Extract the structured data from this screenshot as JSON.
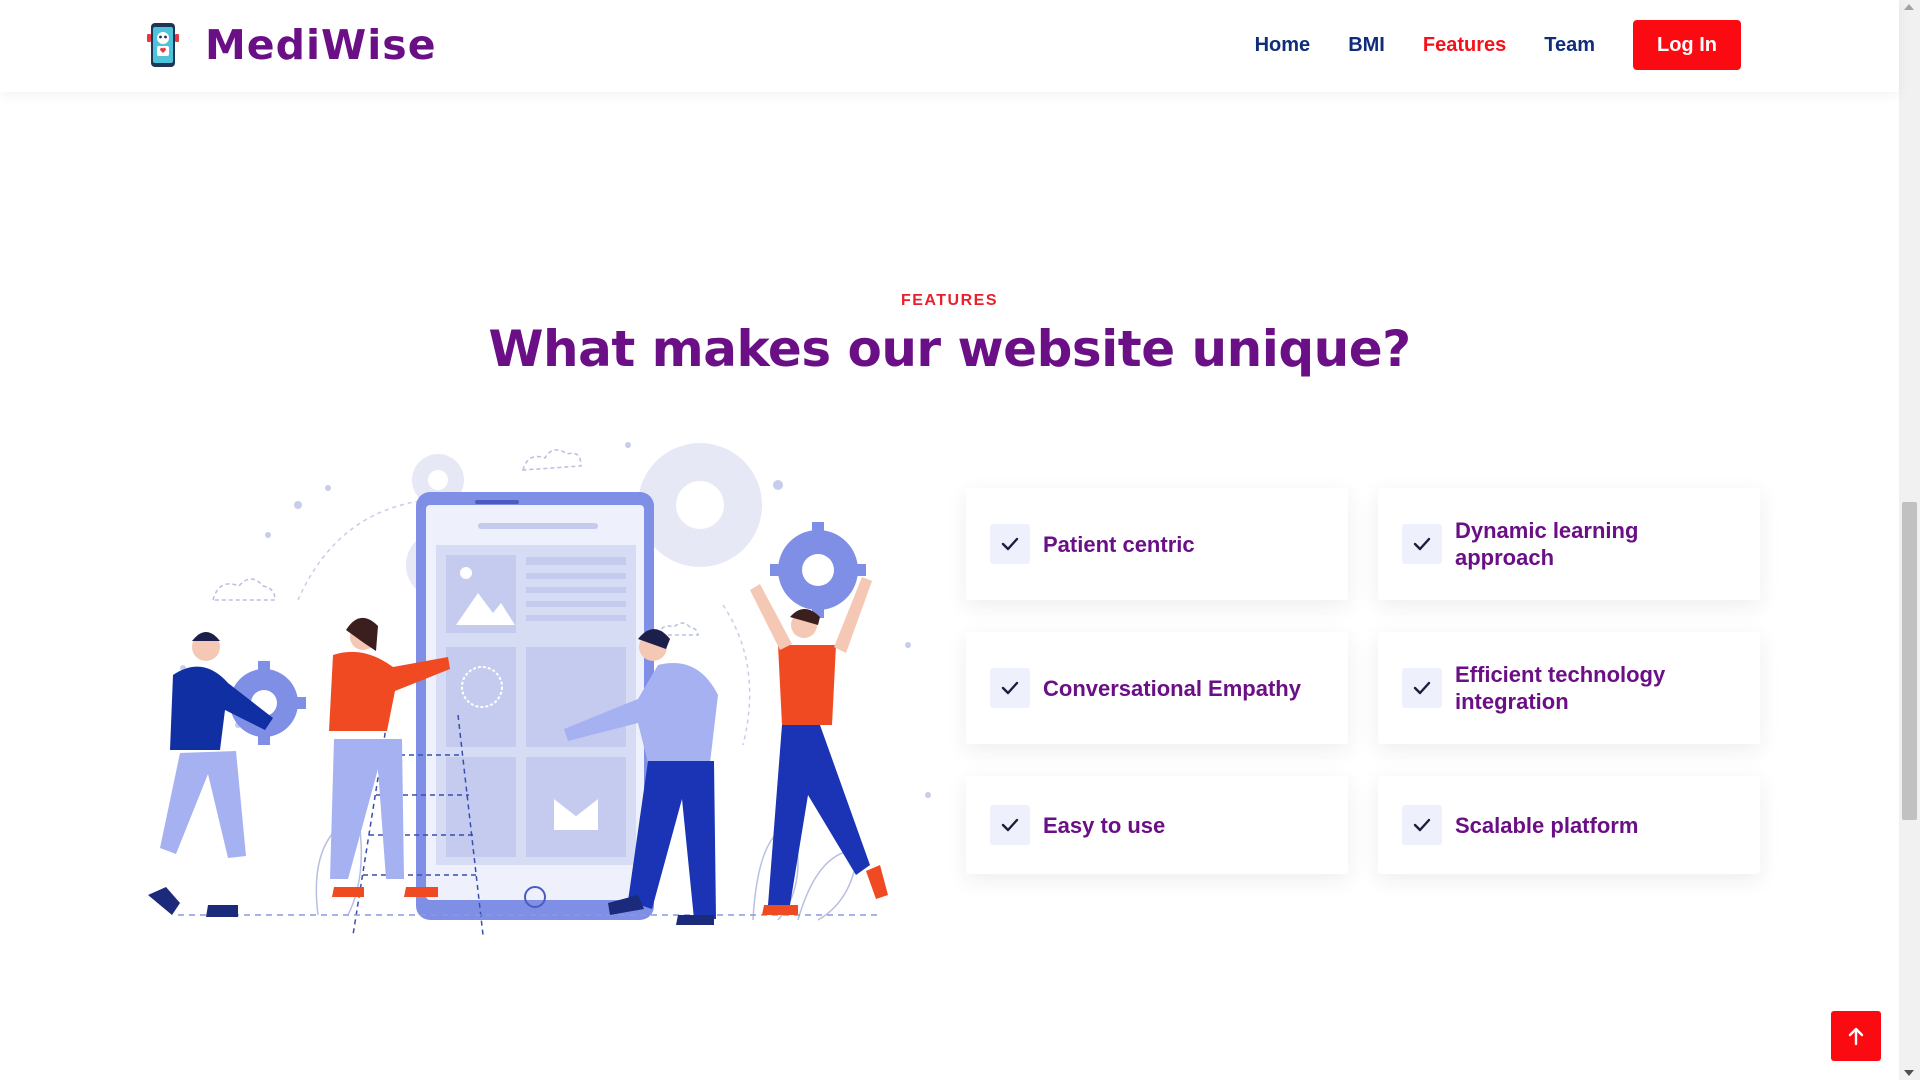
{
  "brand": {
    "name": "MediWise",
    "logo_icon": "robot-phone-icon"
  },
  "nav": {
    "items": [
      {
        "label": "Home"
      },
      {
        "label": "BMI"
      },
      {
        "label": "Features"
      },
      {
        "label": "Team"
      }
    ],
    "active": "Features",
    "login_label": "Log In"
  },
  "section": {
    "eyebrow": "FEATURES",
    "title": "What makes our website unique?"
  },
  "features": [
    {
      "label": "Patient centric",
      "icon": "check-icon"
    },
    {
      "label": "Dynamic learning approach",
      "icon": "check-icon"
    },
    {
      "label": "Conversational Empathy",
      "icon": "check-icon"
    },
    {
      "label": "Efficient technology integration",
      "icon": "check-icon"
    },
    {
      "label": "Easy to use",
      "icon": "check-icon"
    },
    {
      "label": "Scalable platform",
      "icon": "check-icon"
    }
  ],
  "scroll_top": {
    "icon": "arrow-up-icon"
  },
  "colors": {
    "brand_purple": "#6b0f86",
    "accent_red": "#fb0a12",
    "nav_blue": "#0f2d7a"
  }
}
